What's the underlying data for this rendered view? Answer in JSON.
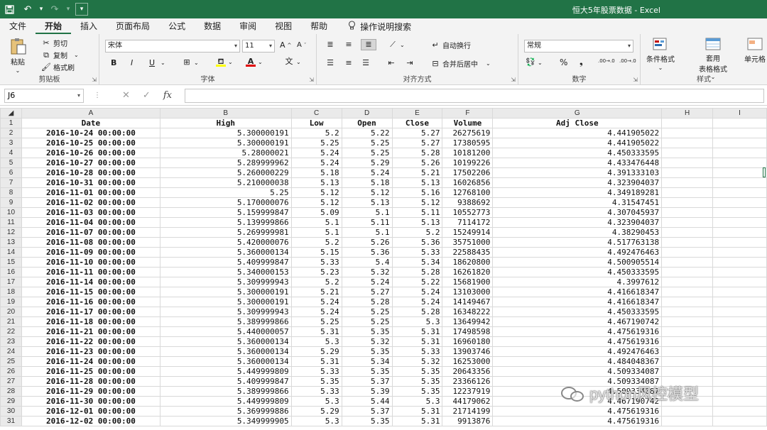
{
  "window": {
    "title": "恒大5年股票数据 - Excel",
    "qa_dropdown": "▾"
  },
  "menu": {
    "tabs": [
      "文件",
      "开始",
      "插入",
      "页面布局",
      "公式",
      "数据",
      "审阅",
      "视图",
      "帮助"
    ],
    "active": "开始",
    "tell_me": "操作说明搜索"
  },
  "ribbon": {
    "clipboard": {
      "paste": "粘贴",
      "cut": "剪切",
      "copy": "复制",
      "format_painter": "格式刷",
      "label": "剪贴板"
    },
    "font": {
      "name": "宋体",
      "size": "11",
      "label": "字体",
      "bold": "B",
      "italic": "I",
      "underline": "U",
      "grow": "A",
      "shrink": "A",
      "font_color": "A",
      "phonetic": "文"
    },
    "alignment": {
      "wrap": "自动换行",
      "merge": "合并后居中",
      "label": "对齐方式"
    },
    "number": {
      "format": "常规",
      "label": "数字",
      "percent": "%",
      "comma": "❟",
      "inc_decimal": ".00→.0",
      "dec_decimal": ".00→.0"
    },
    "styles": {
      "conditional": "条件格式",
      "table_line1": "套用",
      "table_line2": "表格格式",
      "cell_styles": "单元格",
      "label": "样式"
    }
  },
  "formula_bar": {
    "name_box": "J6",
    "fx": "fx",
    "value": ""
  },
  "columns": [
    "A",
    "B",
    "C",
    "D",
    "E",
    "F",
    "G",
    "H",
    "I"
  ],
  "header_row": [
    "Date",
    "High",
    "Low",
    "Open",
    "Close",
    "Volume",
    "Adj Close"
  ],
  "rows": [
    [
      "2016-10-24 00:00:00",
      "5.300000191",
      "5.2",
      "5.22",
      "5.27",
      "26275619",
      "4.441905022"
    ],
    [
      "2016-10-25 00:00:00",
      "5.300000191",
      "5.25",
      "5.25",
      "5.27",
      "17380595",
      "4.441905022"
    ],
    [
      "2016-10-26 00:00:00",
      "5.28000021",
      "5.24",
      "5.25",
      "5.28",
      "10181200",
      "4.450333595"
    ],
    [
      "2016-10-27 00:00:00",
      "5.289999962",
      "5.24",
      "5.29",
      "5.26",
      "10199226",
      "4.433476448"
    ],
    [
      "2016-10-28 00:00:00",
      "5.260000229",
      "5.18",
      "5.24",
      "5.21",
      "17502206",
      "4.391333103"
    ],
    [
      "2016-10-31 00:00:00",
      "5.210000038",
      "5.13",
      "5.18",
      "5.13",
      "16026856",
      "4.323904037"
    ],
    [
      "2016-11-01 00:00:00",
      "5.25",
      "5.12",
      "5.12",
      "5.16",
      "12768100",
      "4.349189281"
    ],
    [
      "2016-11-02 00:00:00",
      "5.170000076",
      "5.12",
      "5.13",
      "5.12",
      "9388692",
      "4.31547451"
    ],
    [
      "2016-11-03 00:00:00",
      "5.159999847",
      "5.09",
      "5.1",
      "5.11",
      "10552773",
      "4.307045937"
    ],
    [
      "2016-11-04 00:00:00",
      "5.139999866",
      "5.1",
      "5.11",
      "5.13",
      "7114172",
      "4.323904037"
    ],
    [
      "2016-11-07 00:00:00",
      "5.269999981",
      "5.1",
      "5.1",
      "5.2",
      "15249914",
      "4.38290453"
    ],
    [
      "2016-11-08 00:00:00",
      "5.420000076",
      "5.2",
      "5.26",
      "5.36",
      "35751000",
      "4.517763138"
    ],
    [
      "2016-11-09 00:00:00",
      "5.360000134",
      "5.15",
      "5.36",
      "5.33",
      "22588435",
      "4.492476463"
    ],
    [
      "2016-11-10 00:00:00",
      "5.409999847",
      "5.33",
      "5.4",
      "5.34",
      "18620800",
      "4.500905514"
    ],
    [
      "2016-11-11 00:00:00",
      "5.340000153",
      "5.23",
      "5.32",
      "5.28",
      "16261820",
      "4.450333595"
    ],
    [
      "2016-11-14 00:00:00",
      "5.309999943",
      "5.2",
      "5.24",
      "5.22",
      "15681900",
      "4.3997612"
    ],
    [
      "2016-11-15 00:00:00",
      "5.300000191",
      "5.21",
      "5.27",
      "5.24",
      "13103000",
      "4.416618347"
    ],
    [
      "2016-11-16 00:00:00",
      "5.300000191",
      "5.24",
      "5.28",
      "5.24",
      "14149467",
      "4.416618347"
    ],
    [
      "2016-11-17 00:00:00",
      "5.309999943",
      "5.24",
      "5.25",
      "5.28",
      "16348222",
      "4.450333595"
    ],
    [
      "2016-11-18 00:00:00",
      "5.389999866",
      "5.25",
      "5.25",
      "5.3",
      "13649942",
      "4.467190742"
    ],
    [
      "2016-11-21 00:00:00",
      "5.440000057",
      "5.31",
      "5.35",
      "5.31",
      "17498598",
      "4.475619316"
    ],
    [
      "2016-11-22 00:00:00",
      "5.360000134",
      "5.3",
      "5.32",
      "5.31",
      "16960180",
      "4.475619316"
    ],
    [
      "2016-11-23 00:00:00",
      "5.360000134",
      "5.29",
      "5.35",
      "5.33",
      "13903746",
      "4.492476463"
    ],
    [
      "2016-11-24 00:00:00",
      "5.360000134",
      "5.31",
      "5.34",
      "5.32",
      "16253000",
      "4.484048367"
    ],
    [
      "2016-11-25 00:00:00",
      "5.449999809",
      "5.33",
      "5.35",
      "5.35",
      "20643356",
      "4.509334087"
    ],
    [
      "2016-11-28 00:00:00",
      "5.409999847",
      "5.35",
      "5.37",
      "5.35",
      "23366126",
      "4.509334087"
    ],
    [
      "2016-11-29 00:00:00",
      "5.389999866",
      "5.33",
      "5.39",
      "5.35",
      "12237919",
      "4.509334087"
    ],
    [
      "2016-11-30 00:00:00",
      "5.449999809",
      "5.3",
      "5.44",
      "5.3",
      "44179062",
      "4.467190742"
    ],
    [
      "2016-12-01 00:00:00",
      "5.369999886",
      "5.29",
      "5.37",
      "5.31",
      "21714199",
      "4.475619316"
    ],
    [
      "2016-12-02 00:00:00",
      "5.349999905",
      "5.3",
      "5.35",
      "5.31",
      "9913876",
      "4.475619316"
    ]
  ],
  "watermark": "python风控模型",
  "colors": {
    "excel_green": "#217346",
    "ribbon_bg": "#f3f3f3",
    "header_bg": "#eaeaea"
  }
}
